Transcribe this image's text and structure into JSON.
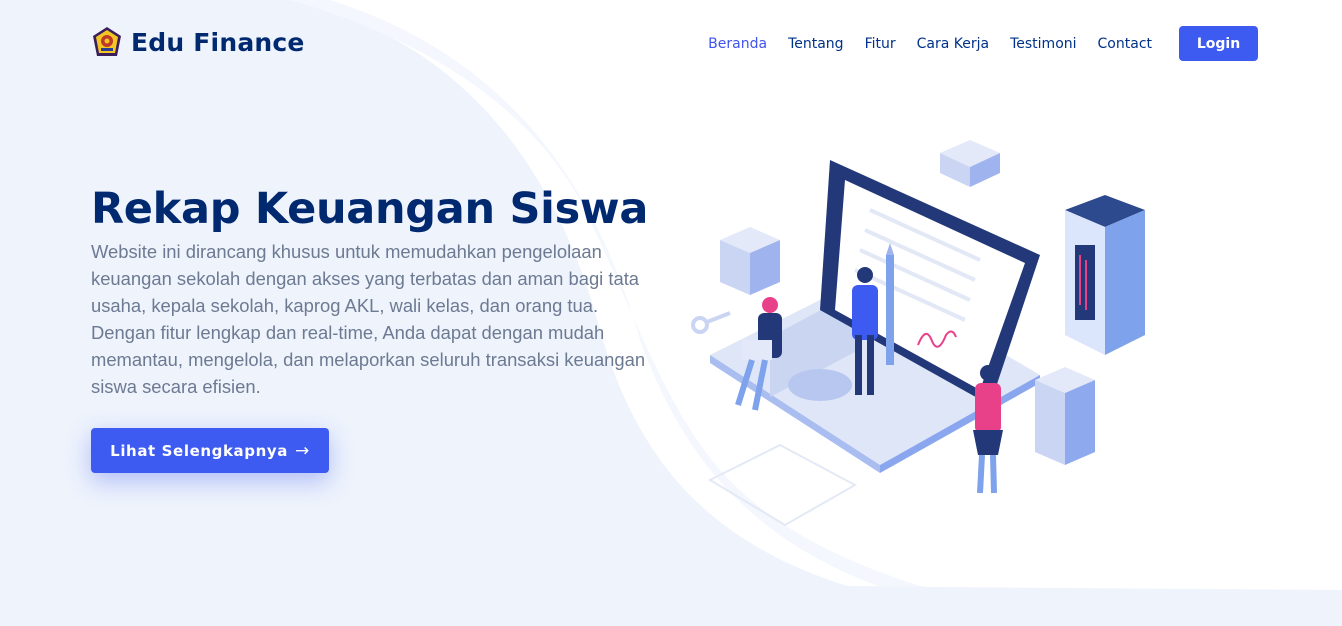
{
  "brand": {
    "name": "Edu Finance",
    "logo_icon": "school-emblem-icon"
  },
  "nav": {
    "items": [
      {
        "label": "Beranda",
        "active": true
      },
      {
        "label": "Tentang"
      },
      {
        "label": "Fitur"
      },
      {
        "label": "Cara Kerja"
      },
      {
        "label": "Testimoni"
      },
      {
        "label": "Contact"
      }
    ],
    "login_label": "Login"
  },
  "hero": {
    "title": "Rekap Keuangan Siswa",
    "description": "Website ini dirancang khusus untuk memudahkan pengelolaan keuangan sekolah dengan akses yang terbatas dan aman bagi tata usaha, kepala sekolah, kaprog AKL, wali kelas, dan orang tua. Dengan fitur lengkap dan real-time, Anda dapat dengan mudah memantau, mengelola, dan melaporkan seluruh transaksi keuangan siswa secara efisien.",
    "cta_label": "Lihat Selengkapnya",
    "cta_icon": "arrow-right-icon",
    "illustration": "isometric-laptop-finance-illustration"
  },
  "colors": {
    "primary": "#3d5af1",
    "heading": "#012970",
    "nav_text": "#013289",
    "nav_active": "#4154f1",
    "body_text": "#6c7a92",
    "background_tint": "#f0f4fc"
  }
}
